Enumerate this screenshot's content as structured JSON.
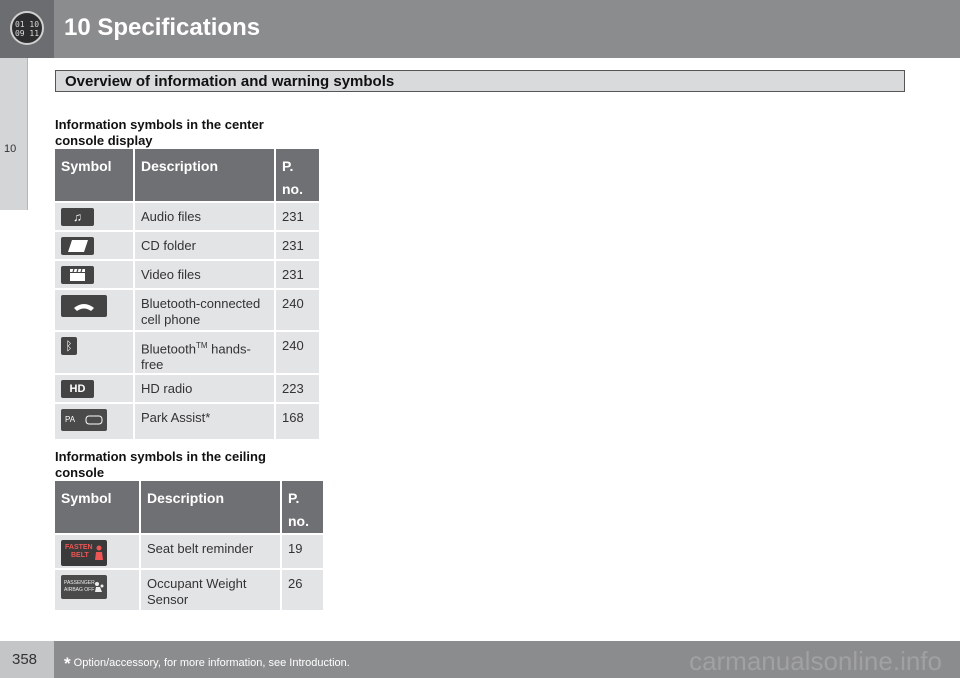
{
  "header": {
    "chapter_icon_text": "01 10\n09 11",
    "chapter_title": "10  Specifications"
  },
  "sidebar": {
    "chapter_number": "10"
  },
  "section_title": "Overview of information and warning symbols",
  "center_console": {
    "heading_line1": "Information symbols in the center",
    "heading_line2": "console display",
    "columns": [
      "Symbol",
      "Description",
      "P.",
      "no."
    ],
    "rows": [
      {
        "icon": "music-note-icon",
        "description": "Audio files",
        "page": "231"
      },
      {
        "icon": "folder-icon",
        "description": "CD folder",
        "page": "231"
      },
      {
        "icon": "clapperboard-icon",
        "description": "Video files",
        "page": "231"
      },
      {
        "icon": "phone-handset-icon",
        "description_line1": "Bluetooth-connected",
        "description_line2": "cell phone",
        "page": "240"
      },
      {
        "icon": "bluetooth-icon",
        "description_pre": "Bluetooth",
        "description_sup": "TM",
        "description_post": " hands-",
        "description_line2": "free",
        "page": "240"
      },
      {
        "icon": "hd-radio-icon",
        "icon_text": "HD",
        "description": "HD radio",
        "page": "223"
      },
      {
        "icon": "park-assist-icon",
        "icon_text": "PA",
        "description": "Park Assist*",
        "page": "168"
      }
    ]
  },
  "ceiling_console": {
    "heading_line1": "Information symbols in the ceiling",
    "heading_line2": "console",
    "columns": [
      "Symbol",
      "Description",
      "P.",
      "no."
    ],
    "rows": [
      {
        "icon": "fasten-belt-icon",
        "icon_text_line1": "FASTEN",
        "icon_text_line2": "BELT",
        "description": "Seat belt reminder",
        "page": "19"
      },
      {
        "icon": "passenger-airbag-off-icon",
        "icon_text_line1": "PASSENGER",
        "icon_text_line2": "AIRBAG  OFF",
        "description_line1": "Occupant Weight",
        "description_line2": "Sensor",
        "page": "26"
      }
    ]
  },
  "footer": {
    "page_number": "358",
    "footnote_star": "*",
    "footnote_text": " Option/accessory, for more information, see Introduction.",
    "watermark": "carmanualsonline.info"
  },
  "colors": {
    "header_bg": "#8b8c8e",
    "table_header_bg": "#6f7073",
    "table_cell_bg": "#e3e4e6"
  }
}
